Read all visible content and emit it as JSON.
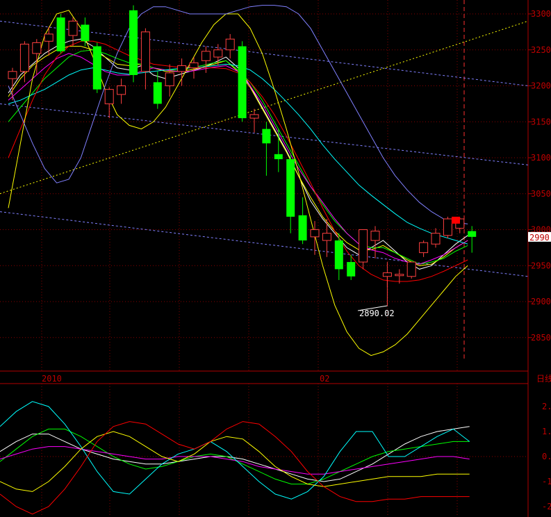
{
  "chart_data": [
    {
      "type": "candlestick",
      "ylim": [
        2800,
        3310
      ],
      "y_ticks": [
        "3300",
        "3250",
        "3200",
        "3150",
        "3100",
        "3050",
        "3000",
        "2950",
        "2900",
        "2850"
      ],
      "x_labels": [
        "2010",
        "02"
      ],
      "period_label": "日线",
      "current_price_label": "2990",
      "min_annotation": "2890.02",
      "candles": [
        {
          "o": 3210,
          "h": 3225,
          "l": 3180,
          "c": 3220
        },
        {
          "o": 3220,
          "h": 3262,
          "l": 3205,
          "c": 3258
        },
        {
          "o": 3245,
          "h": 3265,
          "l": 3215,
          "c": 3260
        },
        {
          "o": 3262,
          "h": 3282,
          "l": 3242,
          "c": 3272
        },
        {
          "o": 3295,
          "h": 3300,
          "l": 3245,
          "c": 3248
        },
        {
          "o": 3270,
          "h": 3295,
          "l": 3255,
          "c": 3290
        },
        {
          "o": 3285,
          "h": 3295,
          "l": 3255,
          "c": 3262
        },
        {
          "o": 3255,
          "h": 3260,
          "l": 3190,
          "c": 3195
        },
        {
          "o": 3175,
          "h": 3198,
          "l": 3155,
          "c": 3195
        },
        {
          "o": 3188,
          "h": 3210,
          "l": 3175,
          "c": 3200
        },
        {
          "o": 3305,
          "h": 3312,
          "l": 3205,
          "c": 3215
        },
        {
          "o": 3220,
          "h": 3280,
          "l": 3195,
          "c": 3275
        },
        {
          "o": 3205,
          "h": 3220,
          "l": 3168,
          "c": 3175
        },
        {
          "o": 3200,
          "h": 3230,
          "l": 3185,
          "c": 3218
        },
        {
          "o": 3220,
          "h": 3238,
          "l": 3200,
          "c": 3228
        },
        {
          "o": 3225,
          "h": 3240,
          "l": 3210,
          "c": 3232
        },
        {
          "o": 3235,
          "h": 3255,
          "l": 3218,
          "c": 3248
        },
        {
          "o": 3240,
          "h": 3258,
          "l": 3228,
          "c": 3250
        },
        {
          "o": 3250,
          "h": 3272,
          "l": 3238,
          "c": 3265
        },
        {
          "o": 3255,
          "h": 3262,
          "l": 3150,
          "c": 3155
        },
        {
          "o": 3155,
          "h": 3168,
          "l": 3135,
          "c": 3160
        },
        {
          "o": 3140,
          "h": 3150,
          "l": 3075,
          "c": 3120
        },
        {
          "o": 3105,
          "h": 3140,
          "l": 3080,
          "c": 3098
        },
        {
          "o": 3098,
          "h": 3105,
          "l": 2995,
          "c": 3018
        },
        {
          "o": 3020,
          "h": 3045,
          "l": 2980,
          "c": 2985
        },
        {
          "o": 2990,
          "h": 3012,
          "l": 2965,
          "c": 3000
        },
        {
          "o": 2985,
          "h": 3015,
          "l": 2962,
          "c": 2995
        },
        {
          "o": 2985,
          "h": 2995,
          "l": 2930,
          "c": 2945
        },
        {
          "o": 2955,
          "h": 2965,
          "l": 2930,
          "c": 2935
        },
        {
          "o": 2955,
          "h": 3000,
          "l": 2945,
          "c": 3000
        },
        {
          "o": 2985,
          "h": 3005,
          "l": 2960,
          "c": 2998
        },
        {
          "o": 2935,
          "h": 2955,
          "l": 2920,
          "c": 2940
        },
        {
          "o": 2936,
          "h": 2945,
          "l": 2925,
          "c": 2938
        },
        {
          "o": 2935,
          "h": 2955,
          "l": 2932,
          "c": 2955
        },
        {
          "o": 2968,
          "h": 2985,
          "l": 2962,
          "c": 2982
        },
        {
          "o": 2980,
          "h": 3002,
          "l": 2975,
          "c": 2995
        },
        {
          "o": 2992,
          "h": 3018,
          "l": 2988,
          "c": 3015
        },
        {
          "o": 3002,
          "h": 3017,
          "l": 2995,
          "c": 3015
        },
        {
          "o": 2998,
          "h": 3005,
          "l": 2968,
          "c": 2990
        }
      ],
      "series": [
        {
          "color": "#ffffff",
          "values": [
            3190,
            3215,
            3230,
            3245,
            3255,
            3262,
            3265,
            3255,
            3240,
            3225,
            3222,
            3228,
            3215,
            3210,
            3215,
            3220,
            3225,
            3232,
            3240,
            3225,
            3200,
            3170,
            3140,
            3110,
            3075,
            3040,
            3015,
            2995,
            2975,
            2965,
            2975,
            2985,
            2970,
            2955,
            2945,
            2950,
            2965,
            2980,
            2992
          ]
        },
        {
          "color": "#ffff00",
          "values": [
            3185,
            3210,
            3228,
            3240,
            3250,
            3255,
            3255,
            3250,
            3240,
            3230,
            3228,
            3230,
            3225,
            3220,
            3220,
            3222,
            3226,
            3230,
            3235,
            3220,
            3198,
            3168,
            3138,
            3108,
            3075,
            3045,
            3018,
            2998,
            2982,
            2972,
            2972,
            2978,
            2968,
            2958,
            2950,
            2952,
            2962,
            2975,
            2985
          ]
        },
        {
          "color": "#00ff00",
          "values": [
            3150,
            3170,
            3190,
            3210,
            3225,
            3240,
            3248,
            3250,
            3245,
            3238,
            3232,
            3230,
            3225,
            3222,
            3222,
            3225,
            3228,
            3232,
            3235,
            3222,
            3205,
            3180,
            3150,
            3120,
            3090,
            3060,
            3035,
            3012,
            2995,
            2980,
            2975,
            2975,
            2968,
            2960,
            2952,
            2955,
            2960,
            2970,
            2978
          ]
        },
        {
          "color": "#ff00ff",
          "values": [
            3180,
            3195,
            3210,
            3225,
            3238,
            3245,
            3240,
            3230,
            3220,
            3215,
            3215,
            3220,
            3225,
            3222,
            3220,
            3220,
            3223,
            3226,
            3228,
            3220,
            3200,
            3175,
            3145,
            3115,
            3085,
            3060,
            3038,
            3015,
            2995,
            2980,
            2972,
            2968,
            2960,
            2955,
            2952,
            2958,
            2965,
            2975,
            2985
          ]
        },
        {
          "color": "#00ffff",
          "values": [
            3175,
            3180,
            3188,
            3195,
            3205,
            3215,
            3222,
            3225,
            3222,
            3218,
            3216,
            3218,
            3220,
            3222,
            3224,
            3225,
            3226,
            3228,
            3230,
            3228,
            3222,
            3210,
            3195,
            3178,
            3160,
            3140,
            3118,
            3098,
            3080,
            3062,
            3048,
            3035,
            3022,
            3010,
            3002,
            2995,
            2990,
            2985,
            2980
          ]
        },
        {
          "color": "#ff0000",
          "values": [
            3100,
            3140,
            3180,
            3215,
            3240,
            3255,
            3262,
            3262,
            3258,
            3250,
            3242,
            3236,
            3230,
            3228,
            3226,
            3226,
            3225,
            3225,
            3224,
            3218,
            3205,
            3185,
            3160,
            3130,
            3098,
            3065,
            3030,
            2998,
            2970,
            2950,
            2938,
            2930,
            2928,
            2928,
            2930,
            2935,
            2942,
            2950,
            2958
          ]
        }
      ],
      "upper_yellow_values": [
        3030,
        3120,
        3210,
        3270,
        3300,
        3305,
        3280,
        3240,
        3195,
        3160,
        3145,
        3140,
        3150,
        3170,
        3200,
        3230,
        3260,
        3285,
        3300,
        3300,
        3280,
        3245,
        3195,
        3140,
        3080,
        3015,
        2950,
        2895,
        2858,
        2835,
        2825,
        2830,
        2840,
        2855,
        2875,
        2895,
        2915,
        2935,
        2950
      ]
    },
    {
      "type": "line",
      "ylim": [
        -2.3,
        2.5
      ],
      "y_ticks": [
        "2.",
        "1.",
        "0.",
        "-1.",
        "-2."
      ],
      "series": [
        {
          "color": "#ffffff",
          "values": [
            0.2,
            0.6,
            0.9,
            0.9,
            0.6,
            0.3,
            0.1,
            -0.1,
            -0.2,
            -0.3,
            -0.3,
            -0.2,
            -0.1,
            0.0,
            0.0,
            -0.1,
            -0.3,
            -0.5,
            -0.7,
            -0.9,
            -1.0,
            -0.9,
            -0.6,
            -0.3,
            0.1,
            0.5,
            0.8,
            1.0,
            1.1,
            1.2
          ]
        },
        {
          "color": "#00ff00",
          "values": [
            -0.2,
            0.3,
            0.8,
            1.1,
            1.1,
            0.8,
            0.4,
            0.0,
            -0.3,
            -0.5,
            -0.4,
            -0.2,
            0.0,
            0.1,
            0.0,
            -0.3,
            -0.6,
            -0.9,
            -1.1,
            -1.1,
            -0.9,
            -0.6,
            -0.3,
            0.0,
            0.2,
            0.3,
            0.4,
            0.5,
            0.6,
            0.6
          ]
        },
        {
          "color": "#ff00ff",
          "values": [
            -0.1,
            0.1,
            0.3,
            0.4,
            0.4,
            0.3,
            0.2,
            0.1,
            0.0,
            -0.1,
            -0.1,
            0.0,
            0.0,
            0.0,
            -0.1,
            -0.2,
            -0.4,
            -0.5,
            -0.6,
            -0.7,
            -0.7,
            -0.6,
            -0.5,
            -0.4,
            -0.3,
            -0.2,
            -0.1,
            0.0,
            0.0,
            -0.1
          ]
        },
        {
          "color": "#00ffff",
          "values": [
            1.2,
            1.8,
            2.2,
            2.0,
            1.3,
            0.4,
            -0.6,
            -1.4,
            -1.5,
            -0.9,
            -0.3,
            0.1,
            0.3,
            0.6,
            0.2,
            -0.4,
            -1.0,
            -1.5,
            -1.7,
            -1.4,
            -0.8,
            0.2,
            1.0,
            1.0,
            0.0,
            0.0,
            0.4,
            0.8,
            1.1,
            0.6
          ]
        },
        {
          "color": "#ffff00",
          "values": [
            -1.0,
            -1.3,
            -1.4,
            -1.0,
            -0.4,
            0.3,
            0.8,
            1.0,
            0.8,
            0.4,
            0.0,
            -0.2,
            0.1,
            0.6,
            0.8,
            0.7,
            0.2,
            -0.4,
            -0.8,
            -1.1,
            -1.2,
            -1.1,
            -1.0,
            -0.9,
            -0.8,
            -0.8,
            -0.8,
            -0.7,
            -0.7,
            -0.7
          ]
        },
        {
          "color": "#ff0000",
          "values": [
            -1.5,
            -2.0,
            -2.3,
            -2.0,
            -1.3,
            -0.4,
            0.6,
            1.2,
            1.4,
            1.3,
            0.9,
            0.5,
            0.3,
            0.6,
            1.1,
            1.4,
            1.3,
            0.8,
            0.2,
            -0.6,
            -1.2,
            -1.6,
            -1.8,
            -1.8,
            -1.7,
            -1.7,
            -1.6,
            -1.6,
            -1.6,
            -1.6
          ]
        }
      ]
    }
  ]
}
